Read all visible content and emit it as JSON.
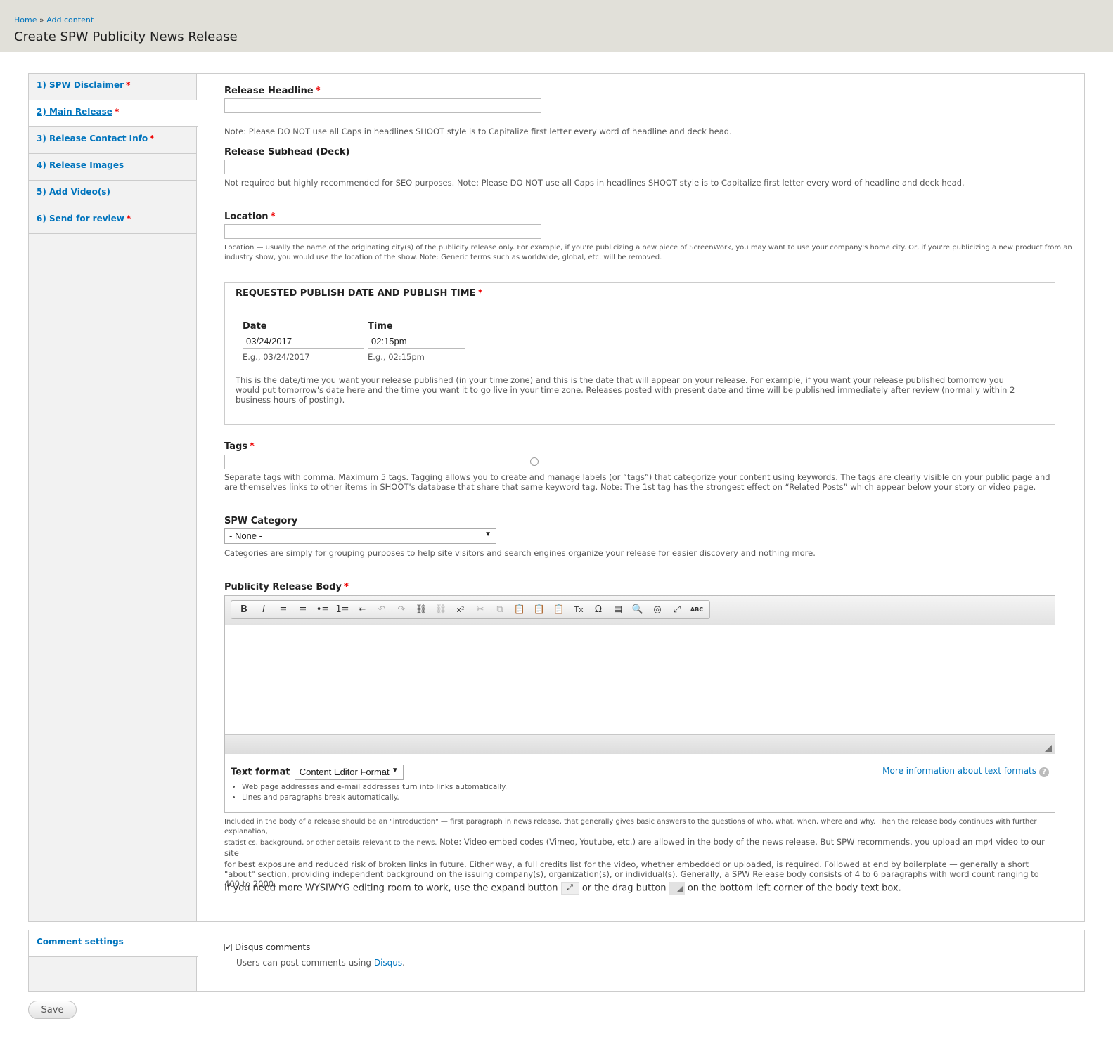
{
  "breadcrumb": {
    "home": "Home",
    "sep": "»",
    "add_content": "Add content"
  },
  "page_title": "Create SPW Publicity News Release",
  "tabs": [
    {
      "label": "1) SPW Disclaimer",
      "required": "*"
    },
    {
      "label": "2) Main Release",
      "required": "*"
    },
    {
      "label": "3) Release Contact Info",
      "required": "*"
    },
    {
      "label": "4) Release Images",
      "required": ""
    },
    {
      "label": "5) Add Video(s)",
      "required": ""
    },
    {
      "label": "6) Send for review",
      "required": "*"
    }
  ],
  "fields": {
    "headline": {
      "label": "Release Headline",
      "required": "*",
      "value": "",
      "note": "Note: Please DO NOT use all Caps in headlines SHOOT style is to Capitalize first letter every word of headline and deck head."
    },
    "subhead": {
      "label": "Release Subhead (Deck)",
      "value": "",
      "note": "Not required but highly recommended for SEO purposes. Note: Please DO NOT use all Caps in headlines SHOOT style is to Capitalize first letter every word of headline and deck head."
    },
    "location": {
      "label": "Location",
      "required": "*",
      "value": "",
      "note_1": "Location — usually the name of the originating city(s) of the publicity release only. For example, if you're publicizing a new piece of ScreenWork, you may want to use your company's home city. Or, if you're publicizing a new product from an",
      "note_2": "industry show, you would use the location of the show. Note: Generic terms such as worldwide, global, etc. will be removed."
    },
    "publish": {
      "legend": "REQUESTED PUBLISH DATE AND PUBLISH TIME",
      "required": "*",
      "date_label": "Date",
      "date_value": "03/24/2017",
      "date_example": "E.g., 03/24/2017",
      "time_label": "Time",
      "time_value": "02:15pm",
      "time_example": "E.g., 02:15pm",
      "note_1": "This is the date/time you want your release published (in your time zone) and this is the date that will appear on your release. For example, if you want your release published tomorrow you",
      "note_2": "would put tomorrow's date here and the time you want it to go live in your time zone. Releases posted with present date and time will be published immediately after review (normally within 2",
      "note_3": "business hours of posting)."
    },
    "tags": {
      "label": "Tags",
      "required": "*",
      "value": "",
      "note_1": "Separate tags with comma. Maximum 5 tags. Tagging allows you to create and manage labels (or “tags”) that categorize your content using keywords. The tags are clearly visible on your public page and",
      "note_2": "are themselves links to other items in SHOOT's database that share that same keyword tag. Note: The 1st tag has the strongest effect on “Related Posts” which appear below your story or video page."
    },
    "category": {
      "label": "SPW Category",
      "selected": "- None -",
      "note": "Categories are simply for grouping purposes to help site visitors and search engines organize your release for easier discovery and nothing more."
    },
    "body": {
      "label": "Publicity Release Body",
      "required": "*",
      "text_format_label": "Text format",
      "text_format_value": "Content Editor Format",
      "more_info": "More information about text formats",
      "tips": [
        "Web page addresses and e-mail addresses turn into links automatically.",
        "Lines and paragraphs break automatically."
      ],
      "note_1": "Included in the body of a release should be an \"introduction\" — first paragraph in news release, that generally gives basic answers to the questions of who, what, when, where and why. Then the release body continues with further explanation,",
      "note_2": "statistics, background, or other details relevant to the news.",
      "note_3": " Note: Video embed codes (Vimeo, Youtube, etc.) are allowed in the body of the news release. But SPW recommends, you upload an mp4 video to our site",
      "note_4": "for best exposure and reduced risk of broken links in future. Either way, a full credits list for the video, whether embedded or uploaded, is required. Followed at end by boilerplate — generally a short",
      "note_5": "\"about\" section, providing independent background on the issuing company(s), organization(s), or individual(s). Generally, a SPW Release body consists of 4 to 6 paragraphs with word count ranging to",
      "note_6": "400 to 2000.",
      "expand_part1": "If you need more WYSIWYG editing room to work, use the expand button",
      "expand_part2": "or the drag button",
      "expand_part3": "on the bottom left corner of the body text box."
    }
  },
  "toolbar_icons": [
    "bold-icon",
    "italic-icon",
    "align-left-icon",
    "align-center-icon",
    "bulleted-list-icon",
    "numbered-list-icon",
    "outdent-icon",
    "undo-icon",
    "redo-icon",
    "link-icon",
    "unlink-icon",
    "superscript-icon",
    "cut-icon",
    "copy-icon",
    "paste-icon",
    "paste-text-icon",
    "paste-word-icon",
    "remove-format-icon",
    "special-char-icon",
    "show-blocks-icon",
    "find-icon",
    "source-icon",
    "maximize-icon",
    "spellcheck-icon"
  ],
  "toolbar_glyphs": [
    "B",
    "I",
    "≡",
    "≡",
    "•≡",
    "1≡",
    "⇤",
    "↶",
    "↷",
    "⛓",
    "⛓",
    "x²",
    "✂",
    "⧉",
    "📋",
    "📋",
    "📋",
    "Tx",
    "Ω",
    "▤",
    "🔍",
    "◎",
    "⤢",
    "ABC"
  ],
  "comments": {
    "tab_label": "Comment settings",
    "checkbox_label": "Disqus comments",
    "description": "Users can post comments using",
    "link": "Disqus",
    "link_suffix": "."
  },
  "save_label": "Save"
}
